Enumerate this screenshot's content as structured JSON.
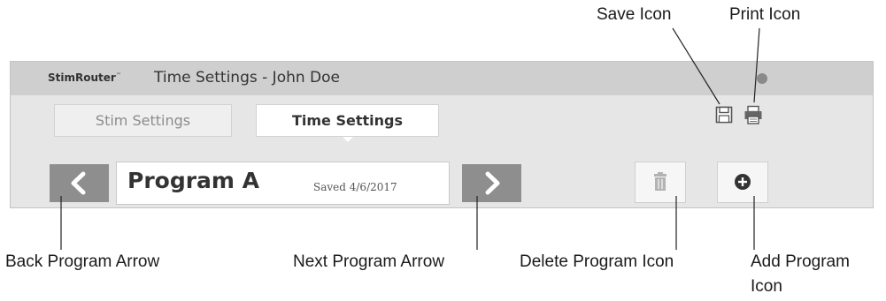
{
  "annotations": {
    "save_icon": "Save Icon",
    "print_icon": "Print Icon",
    "back_program_arrow": "Back Program Arrow",
    "next_program_arrow": "Next Program Arrow",
    "delete_program_icon": "Delete Program Icon",
    "add_program_icon_line1": "Add Program",
    "add_program_icon_line2": "Icon"
  },
  "app": {
    "brand": "StimRouter",
    "brand_mark": "™",
    "window_title": "Time Settings - John Doe"
  },
  "tabs": [
    {
      "label": "Stim Settings",
      "active": false
    },
    {
      "label": "Time Settings",
      "active": true
    }
  ],
  "program": {
    "name": "Program A",
    "saved_status": "Saved 4/6/2017"
  },
  "icons": {
    "save": "save-icon",
    "print": "print-icon",
    "back": "chevron-left-icon",
    "next": "chevron-right-icon",
    "delete": "trash-icon",
    "add": "plus-circle-icon"
  },
  "colors": {
    "panel": "#e6e6e6",
    "titlebar": "#cfcfcf",
    "nav_button": "#8e8e8e"
  }
}
